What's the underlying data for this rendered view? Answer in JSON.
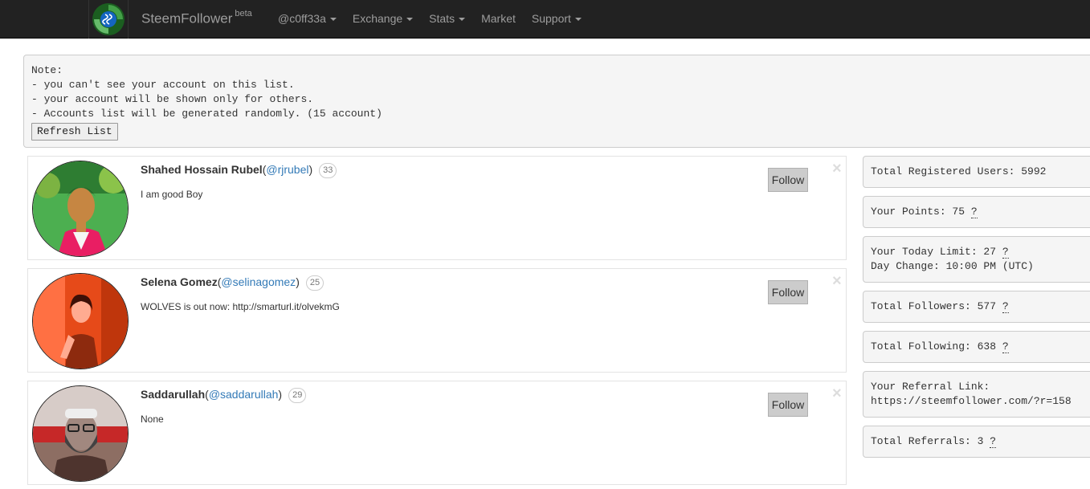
{
  "navbar": {
    "brand": "SteemFollower",
    "brand_sup": "beta",
    "menu": [
      {
        "label": "@c0ff33a",
        "dropdown": true
      },
      {
        "label": "Exchange",
        "dropdown": true
      },
      {
        "label": "Stats",
        "dropdown": true
      },
      {
        "label": "Market",
        "dropdown": false
      },
      {
        "label": "Support",
        "dropdown": true
      }
    ],
    "logo_icon": "steem-logo-icon"
  },
  "note": {
    "lines": [
      "Note:",
      "- you can't see your account on this list.",
      "- your account will be shown only for others.",
      "- Accounts list will be generated randomly. (15 account)"
    ],
    "refresh_label": "Refresh List"
  },
  "users": [
    {
      "name": "Shahed Hossain Rubel",
      "handle": "@rjrubel",
      "rep": "33",
      "bio": "I am good Boy",
      "follow_label": "Follow"
    },
    {
      "name": "Selena Gomez",
      "handle": "@selinagomez",
      "rep": "25",
      "bio": "WOLVES is out now: http://smarturl.it/olvekmG",
      "follow_label": "Follow"
    },
    {
      "name": "Saddarullah",
      "handle": "@saddarullah",
      "rep": "29",
      "bio": "None",
      "follow_label": "Follow"
    }
  ],
  "stats": {
    "registered": "Total Registered Users: 5992",
    "points": "Your Points: 75",
    "today_limit": "Your Today Limit: 27",
    "day_change": "Day Change: 10:00 PM (UTC)",
    "followers": "Total Followers: 577",
    "following": "Total Following: 638",
    "referral_label": "Your Referral Link:",
    "referral_link": "https://steemfollower.com/?r=158",
    "referrals": "Total Referrals: 3",
    "help_mark": "?"
  },
  "colors": {
    "navbar_bg": "#222222",
    "nav_text": "#9d9d9d",
    "link": "#337ab7",
    "logo_green": "#4caf50",
    "logo_blue": "#1e88e5"
  }
}
